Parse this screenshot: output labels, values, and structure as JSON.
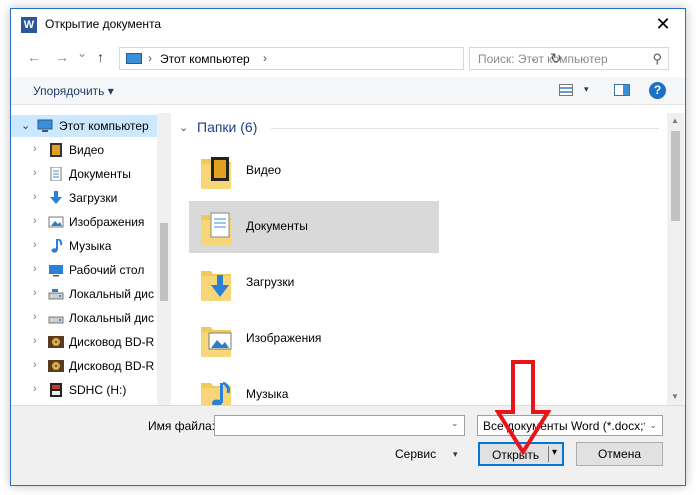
{
  "window": {
    "title": "Открытие документа",
    "app_icon_letter": "W",
    "close_glyph": "✕"
  },
  "navbar": {
    "back_glyph": "←",
    "forward_glyph": "→",
    "recent_glyph": "⌄",
    "up_glyph": "↑",
    "address_sep": "›",
    "address_text": "Этот компьютер",
    "address_sep_end": "›",
    "address_down": "⌄",
    "refresh_glyph": "↻",
    "search_placeholder": "Поиск: Этот компьютер",
    "search_glyph": "⚲"
  },
  "toolbar": {
    "organize_label": "Упорядочить ▾",
    "view_down": "▾",
    "help_label": "?"
  },
  "nav_pane": {
    "items": [
      {
        "label": "Этот компьютер",
        "icon": "computer-icon",
        "chev": "⌄"
      },
      {
        "label": "Видео",
        "icon": "video-icon",
        "chev": "›"
      },
      {
        "label": "Документы",
        "icon": "documents-icon",
        "chev": "›"
      },
      {
        "label": "Загрузки",
        "icon": "downloads-icon",
        "chev": "›"
      },
      {
        "label": "Изображения",
        "icon": "pictures-icon",
        "chev": "›"
      },
      {
        "label": "Музыка",
        "icon": "music-icon",
        "chev": "›"
      },
      {
        "label": "Рабочий стол",
        "icon": "desktop-icon",
        "chev": "›"
      },
      {
        "label": "Локальный дис",
        "icon": "local-disk-icon",
        "chev": "›"
      },
      {
        "label": "Локальный дис",
        "icon": "local-disk-icon",
        "chev": "›"
      },
      {
        "label": "Дисковод BD-R",
        "icon": "bd-drive-icon",
        "chev": "›"
      },
      {
        "label": "Дисковод BD-R",
        "icon": "bd-drive-icon",
        "chev": "›"
      },
      {
        "label": "SDHC (H:)",
        "icon": "sd-card-icon",
        "chev": "›"
      }
    ]
  },
  "content": {
    "group_chev": "⌄",
    "group_title": "Папки (6)",
    "folders": [
      {
        "label": "Видео",
        "icon": "video-folder-icon"
      },
      {
        "label": "Документы",
        "icon": "documents-folder-icon"
      },
      {
        "label": "Загрузки",
        "icon": "downloads-folder-icon"
      },
      {
        "label": "Изображения",
        "icon": "pictures-folder-icon"
      },
      {
        "label": "Музыка",
        "icon": "music-folder-icon"
      }
    ],
    "scroll_up": "▲",
    "scroll_down": "▼"
  },
  "bottom": {
    "filename_label": "Имя файла:",
    "filename_value": "",
    "filename_down": "⌄",
    "filetype_value": "Все документы Word (*.docx;*",
    "filetype_down": "⌄",
    "service_label": "Сервис",
    "service_down": "▾",
    "open_label": "Открыть",
    "open_down": "▾",
    "cancel_label": "Отмена"
  },
  "colors": {
    "accent": "#0078d7",
    "selection": "#cce8ff",
    "arrow_annotation": "#e8141c"
  }
}
